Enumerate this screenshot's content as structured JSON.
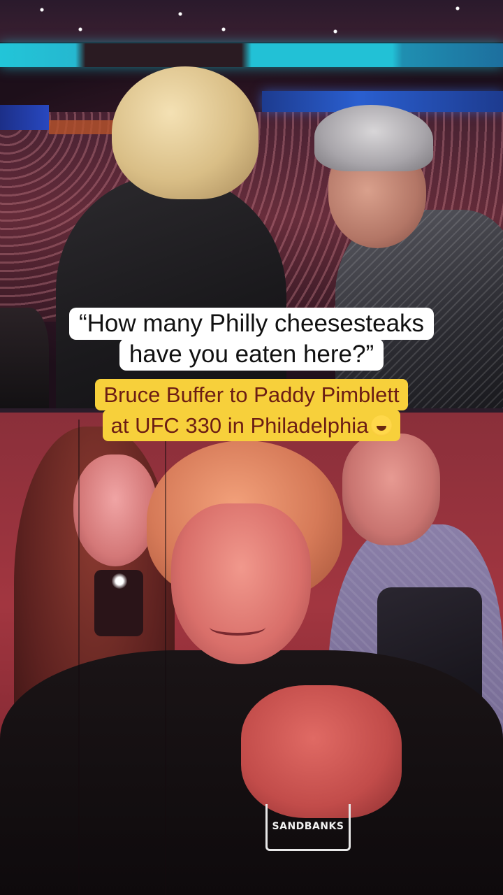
{
  "caption": {
    "quote_line1": "“How many Philly cheesesteaks",
    "quote_line2": "have you eaten here?”",
    "context_line1": "Bruce Buffer to Paddy Pimblett",
    "context_line2": "at UFC 330 in Philadelphia",
    "emoji_icon": "rolling-on-floor-laughing-emoji",
    "quote_bg": "#ffffff",
    "context_bg": "#f7d03b",
    "context_text_color": "#6b1d14"
  },
  "shirt_logo": {
    "text": "SANDBANKS"
  }
}
